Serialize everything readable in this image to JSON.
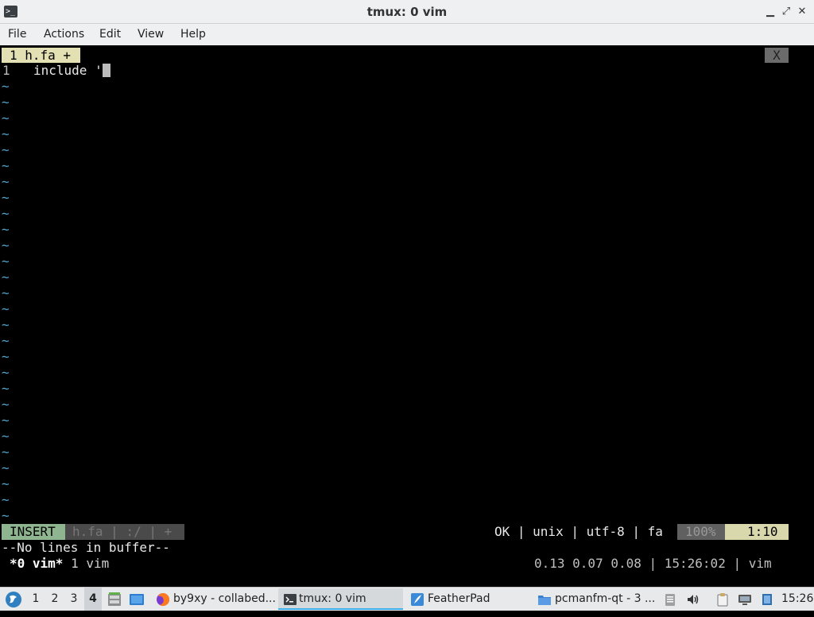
{
  "window": {
    "title": "tmux: 0 vim",
    "minimize": "▁",
    "maximize": "⤢",
    "close": "✕"
  },
  "menu": [
    "File",
    "Actions",
    "Edit",
    "View",
    "Help"
  ],
  "vim": {
    "tab_label": "1 h.fa +",
    "tab_close": "X",
    "line_number": "1",
    "line_text": "include '",
    "tilde": "~",
    "tilde_count": 28,
    "status": {
      "mode": "INSERT",
      "file": "h.fa | :/ | +",
      "info": "OK | unix | utf-8 | fa",
      "percent": "100%",
      "position": "1:10"
    },
    "message": "--No lines in buffer--"
  },
  "tmux": {
    "active_window": "*0 vim*",
    "other_window": "1 vim",
    "right_status": "0.13 0.07 0.08 | 15:26:02 | vim"
  },
  "taskbar": {
    "workspaces": [
      "1",
      "2",
      "3",
      "4"
    ],
    "active_workspace": "4",
    "tasks": [
      {
        "label": "by9xy - collabed...",
        "icon": "firefox-icon"
      },
      {
        "label": "tmux: 0 vim",
        "icon": "terminal-icon"
      },
      {
        "label": "FeatherPad",
        "icon": "featherpad-icon"
      },
      {
        "label": "pcmanfm-qt - 3 ...",
        "icon": "folder-icon"
      }
    ],
    "clock": "15:26"
  },
  "colors": {
    "accent": "#3daee9",
    "tilde": "#4fa6c9",
    "mode_bg": "#8eb590",
    "position_bg": "#d9d7ac",
    "tab_bg": "#e3e0b4"
  }
}
